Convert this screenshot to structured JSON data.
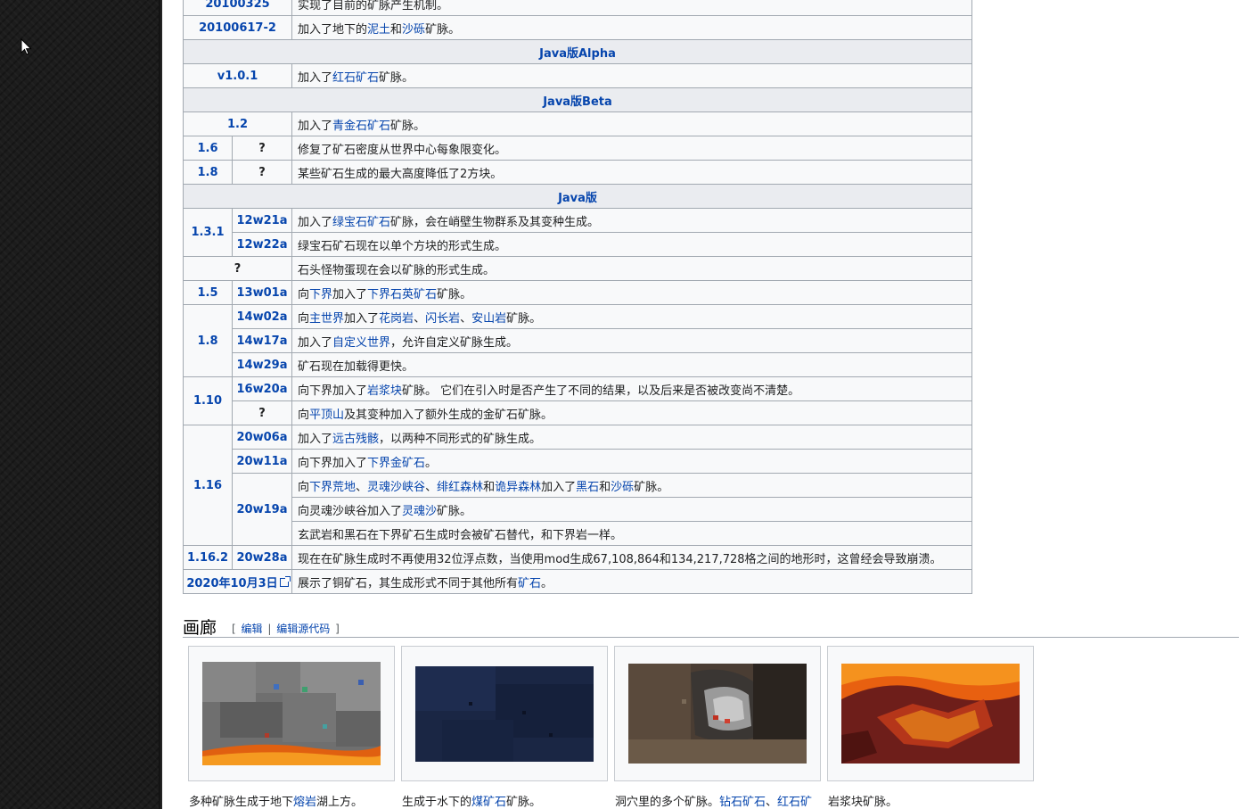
{
  "history_rows": [
    {
      "type": "full",
      "version": "20100325",
      "desc": [
        {
          "t": "实现了目前的矿脉产生机制。"
        }
      ]
    },
    {
      "type": "full",
      "version": "20100617-2",
      "desc": [
        {
          "t": "加入了地下的"
        },
        {
          "t": "泥土",
          "link": true
        },
        {
          "t": "和"
        },
        {
          "t": "沙砾",
          "link": true
        },
        {
          "t": "矿脉。"
        }
      ]
    },
    {
      "type": "section",
      "label": "Java版Alpha"
    },
    {
      "type": "full",
      "version": "v1.0.1",
      "desc": [
        {
          "t": "加入了"
        },
        {
          "t": "红石矿石",
          "link": true
        },
        {
          "t": "矿脉。"
        }
      ]
    },
    {
      "type": "section",
      "label": "Java版Beta"
    },
    {
      "type": "full",
      "version": "1.2",
      "desc": [
        {
          "t": "加入了"
        },
        {
          "t": "青金石矿石",
          "link": true
        },
        {
          "t": "矿脉。"
        }
      ]
    },
    {
      "type": "split",
      "version": "1.6",
      "sub": "?",
      "desc": [
        {
          "t": "修复了矿石密度从世界中心每象限变化。"
        }
      ]
    },
    {
      "type": "split",
      "version": "1.8",
      "sub": "?",
      "desc": [
        {
          "t": "某些矿石生成的最大高度降低了2方块。"
        }
      ]
    },
    {
      "type": "section",
      "label": "Java版"
    },
    {
      "type": "split",
      "version": "1.3.1",
      "span": 2,
      "sub": "12w21a",
      "desc": [
        {
          "t": "加入了"
        },
        {
          "t": "绿宝石矿石",
          "link": true
        },
        {
          "t": "矿脉，会在峭壁生物群系及其变种生成。"
        }
      ]
    },
    {
      "type": "sub",
      "sub": "12w22a",
      "desc": [
        {
          "t": "绿宝石矿石现在以单个方块的形式生成。"
        }
      ]
    },
    {
      "type": "full",
      "version": "?",
      "plain": true,
      "desc": [
        {
          "t": "石头怪物蛋现在会以矿脉的形式生成。"
        }
      ]
    },
    {
      "type": "split",
      "version": "1.5",
      "sub": "13w01a",
      "desc": [
        {
          "t": "向"
        },
        {
          "t": "下界",
          "link": true
        },
        {
          "t": "加入了"
        },
        {
          "t": "下界石英矿石",
          "link": true
        },
        {
          "t": "矿脉。"
        }
      ]
    },
    {
      "type": "split",
      "version": "1.8",
      "span": 3,
      "sub": "14w02a",
      "desc": [
        {
          "t": "向"
        },
        {
          "t": "主世界",
          "link": true
        },
        {
          "t": "加入了"
        },
        {
          "t": "花岗岩",
          "link": true
        },
        {
          "t": "、"
        },
        {
          "t": "闪长岩",
          "link": true
        },
        {
          "t": "、"
        },
        {
          "t": "安山岩",
          "link": true
        },
        {
          "t": "矿脉。"
        }
      ]
    },
    {
      "type": "sub",
      "sub": "14w17a",
      "desc": [
        {
          "t": "加入了"
        },
        {
          "t": "自定义世界",
          "link": true
        },
        {
          "t": "，允许自定义矿脉生成。"
        }
      ]
    },
    {
      "type": "sub",
      "sub": "14w29a",
      "desc": [
        {
          "t": "矿石现在加载得更快。"
        }
      ]
    },
    {
      "type": "split",
      "version": "1.10",
      "span": 2,
      "sub": "16w20a",
      "desc": [
        {
          "t": "向下界加入了"
        },
        {
          "t": "岩浆块",
          "link": true
        },
        {
          "t": "矿脉。 它们在引入时是否产生了不同的结果，以及后来是否被改变尚不清楚。"
        }
      ]
    },
    {
      "type": "sub",
      "sub": "?",
      "plain": true,
      "desc": [
        {
          "t": "向"
        },
        {
          "t": "平顶山",
          "link": true
        },
        {
          "t": "及其变种加入了额外生成的金矿石矿脉。"
        }
      ]
    },
    {
      "type": "split",
      "version": "1.16",
      "span": 5,
      "sub": "20w06a",
      "desc": [
        {
          "t": "加入了"
        },
        {
          "t": "远古残骸",
          "link": true
        },
        {
          "t": "，以两种不同形式的矿脉生成。"
        }
      ]
    },
    {
      "type": "sub",
      "sub": "20w11a",
      "desc": [
        {
          "t": "向下界加入了"
        },
        {
          "t": "下界金矿石",
          "link": true
        },
        {
          "t": "。"
        }
      ]
    },
    {
      "type": "sub",
      "sub": "20w19a",
      "span": 3,
      "desc": [
        {
          "t": "向"
        },
        {
          "t": "下界荒地",
          "link": true
        },
        {
          "t": "、"
        },
        {
          "t": "灵魂沙峡谷",
          "link": true
        },
        {
          "t": "、"
        },
        {
          "t": "绯红森林",
          "link": true
        },
        {
          "t": "和"
        },
        {
          "t": "诡异森林",
          "link": true
        },
        {
          "t": "加入了"
        },
        {
          "t": "黑石",
          "link": true
        },
        {
          "t": "和"
        },
        {
          "t": "沙砾",
          "link": true
        },
        {
          "t": "矿脉。"
        }
      ]
    },
    {
      "type": "desc",
      "desc": [
        {
          "t": "向灵魂沙峡谷加入了"
        },
        {
          "t": "灵魂沙",
          "link": true
        },
        {
          "t": "矿脉。"
        }
      ]
    },
    {
      "type": "desc",
      "desc": [
        {
          "t": "玄武岩和黑石在下界矿石生成时会被矿石替代，和下界岩一样。"
        }
      ]
    },
    {
      "type": "split",
      "version": "1.16.2",
      "sub": "20w28a",
      "desc": [
        {
          "t": "现在在矿脉生成时不再使用32位浮点数，当使用mod生成67,108,864和134,217,728格之间的地形时，这曾经会导致崩溃。"
        }
      ]
    },
    {
      "type": "full",
      "version": "2020年10月3日",
      "ext": true,
      "desc": [
        {
          "t": "展示了铜矿石，其生成形式不同于其他所有"
        },
        {
          "t": "矿石",
          "link": true
        },
        {
          "t": "。"
        }
      ]
    }
  ],
  "gallery": {
    "title": "画廊",
    "bracket_open": "[",
    "edit": "编辑",
    "sep": "|",
    "edit_source": "编辑源代码",
    "bracket_close": "]",
    "captions": [
      [
        {
          "t": "多种矿脉生成于地下"
        },
        {
          "t": "熔岩",
          "link": true
        },
        {
          "t": "湖上方。"
        }
      ],
      [
        {
          "t": "生成于水下的"
        },
        {
          "t": "煤矿石",
          "link": true
        },
        {
          "t": "矿脉。"
        }
      ],
      [
        {
          "t": "洞穴里的多个矿脉。"
        },
        {
          "t": "钻石矿石",
          "link": true
        },
        {
          "t": "、"
        },
        {
          "t": "红石矿",
          "link": true
        }
      ],
      [
        {
          "t": "岩浆块矿脉。"
        }
      ]
    ]
  },
  "colors": {
    "link": "#0645ad",
    "border": "#a2a9b1",
    "header_bg": "#eaecf0",
    "cell_bg": "#f8f9fa"
  }
}
